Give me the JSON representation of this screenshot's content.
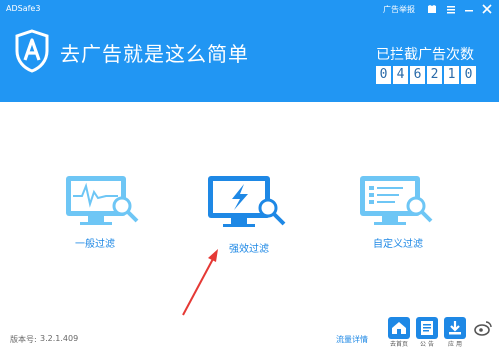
{
  "app": {
    "title": "ADSafe3"
  },
  "topbar": {
    "report_label": "广告举报"
  },
  "header": {
    "slogan": "去广告就是这么简单",
    "counter_label": "已拦截广告次数",
    "counter_digits": [
      "0",
      "4",
      "6",
      "2",
      "1",
      "0"
    ]
  },
  "modes": [
    {
      "label": "一般过滤",
      "icon": "monitor-waveform-search-icon"
    },
    {
      "label": "强效过滤",
      "icon": "monitor-lightning-search-icon"
    },
    {
      "label": "自定义过滤",
      "icon": "monitor-list-search-icon"
    }
  ],
  "footer": {
    "version_label": "版本号:",
    "version_value": "3.2.1.409",
    "traffic_label": "流量详情",
    "dock": [
      {
        "label": "去首页",
        "icon": "home-icon"
      },
      {
        "label": "公 告",
        "icon": "notice-icon"
      },
      {
        "label": "应 用",
        "icon": "apps-download-icon"
      },
      {
        "label": "",
        "icon": "weibo-icon"
      }
    ]
  },
  "colors": {
    "header": "#2196f3",
    "accent": "#1e88e5",
    "arrow": "#e53935"
  }
}
